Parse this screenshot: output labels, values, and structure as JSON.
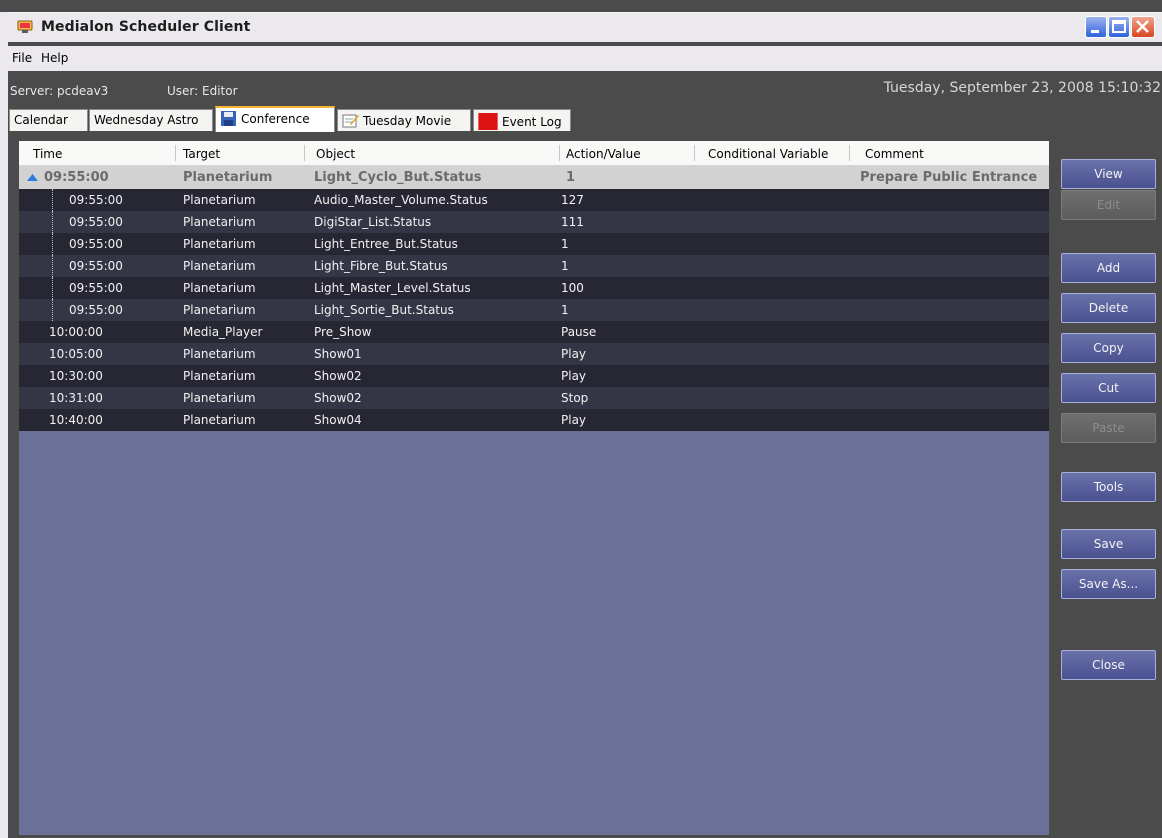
{
  "window": {
    "title": "Medialon Scheduler Client"
  },
  "menu": [
    "File",
    "Help"
  ],
  "info": {
    "server": "Server: pcdeav3",
    "user": "User: Editor",
    "datetime": "Tuesday, September 23, 2008 15:10:32"
  },
  "tabs": [
    {
      "label": "Calendar",
      "icon": ""
    },
    {
      "label": "Wednesday Astro",
      "icon": ""
    },
    {
      "label": "Conference",
      "icon": "floppy-disk-icon",
      "active": true
    },
    {
      "label": "Tuesday Movie",
      "icon": "edit-note-icon"
    },
    {
      "label": "Event Log",
      "icon": "red-square-icon"
    }
  ],
  "grid": {
    "columns": [
      "Time",
      "Target",
      "Object",
      "Action/Value",
      "Conditional Variable",
      "Comment"
    ],
    "parent_row": {
      "time": "09:55:00",
      "target": "Planetarium",
      "object": "Light_Cyclo_But.Status",
      "action": "1",
      "condition": "",
      "comment": "Prepare Public Entrance"
    },
    "child_rows": [
      {
        "time": "09:55:00",
        "target": "Planetarium",
        "object": "Audio_Master_Volume.Status",
        "action": "127"
      },
      {
        "time": "09:55:00",
        "target": "Planetarium",
        "object": "DigiStar_List.Status",
        "action": "111"
      },
      {
        "time": "09:55:00",
        "target": "Planetarium",
        "object": "Light_Entree_But.Status",
        "action": "1"
      },
      {
        "time": "09:55:00",
        "target": "Planetarium",
        "object": "Light_Fibre_But.Status",
        "action": "1"
      },
      {
        "time": "09:55:00",
        "target": "Planetarium",
        "object": "Light_Master_Level.Status",
        "action": "100"
      },
      {
        "time": "09:55:00",
        "target": "Planetarium",
        "object": "Light_Sortie_But.Status",
        "action": "1"
      }
    ],
    "rows": [
      {
        "time": "10:00:00",
        "target": "Media_Player",
        "object": "Pre_Show",
        "action": "Pause"
      },
      {
        "time": "10:05:00",
        "target": "Planetarium",
        "object": "Show01",
        "action": "Play"
      },
      {
        "time": "10:30:00",
        "target": "Planetarium",
        "object": "Show02",
        "action": "Play"
      },
      {
        "time": "10:31:00",
        "target": "Planetarium",
        "object": "Show02",
        "action": "Stop"
      },
      {
        "time": "10:40:00",
        "target": "Planetarium",
        "object": "Show04",
        "action": "Play"
      }
    ]
  },
  "side_buttons": {
    "view": "View",
    "edit": "Edit",
    "add": "Add",
    "delete": "Delete",
    "copy": "Copy",
    "cut": "Cut",
    "paste": "Paste",
    "tools": "Tools",
    "save": "Save",
    "save_as": "Save As...",
    "close": "Close"
  }
}
